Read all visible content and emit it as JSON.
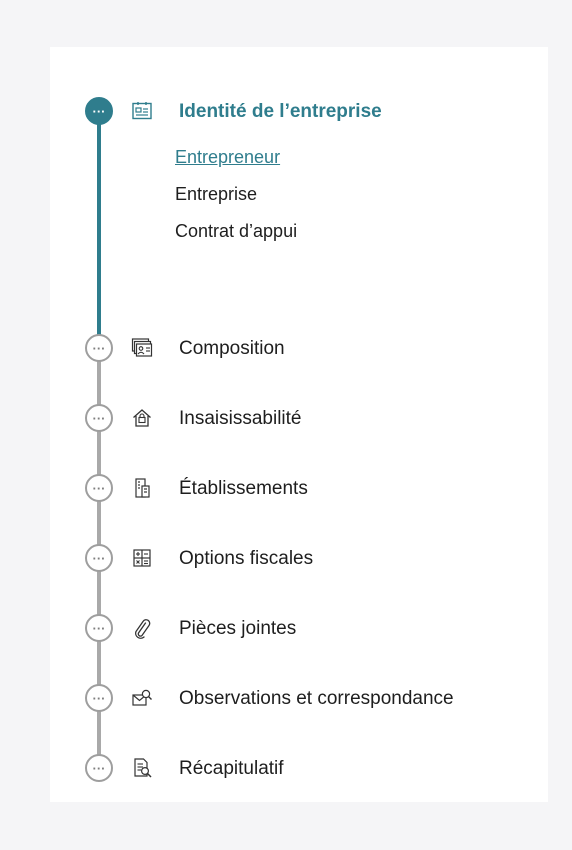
{
  "stepper": {
    "steps": [
      {
        "label": "Identité de l’entreprise",
        "icon": "id-card-icon",
        "state": "active",
        "substeps": [
          "Entrepreneur",
          "Entreprise",
          "Contrat d’appui"
        ],
        "current_substep": "Entrepreneur"
      },
      {
        "label": "Composition",
        "icon": "people-cards-icon",
        "state": "pending"
      },
      {
        "label": "Insaisissabilité",
        "icon": "house-icon",
        "state": "pending"
      },
      {
        "label": "Établissements",
        "icon": "building-icon",
        "state": "pending"
      },
      {
        "label": "Options fiscales",
        "icon": "calculator-icon",
        "state": "pending"
      },
      {
        "label": "Pièces jointes",
        "icon": "paperclip-icon",
        "state": "pending"
      },
      {
        "label": "Observations et correspondance",
        "icon": "mail-search-icon",
        "state": "pending"
      },
      {
        "label": "Récapitulatif",
        "icon": "document-search-icon",
        "state": "pending"
      }
    ],
    "status_glyph": "···"
  },
  "colors": {
    "accent": "#2f7d8d",
    "rail_inactive": "#a9a9a9",
    "background": "#f5f5f7",
    "card": "#ffffff"
  }
}
